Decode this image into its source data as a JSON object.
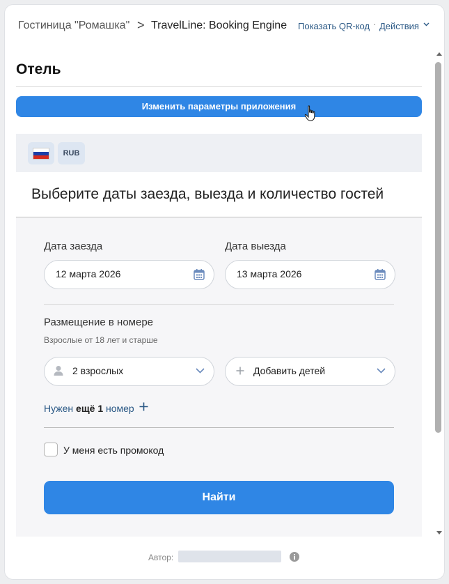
{
  "header": {
    "breadcrumb_parent": "Гостиница \"Ромашка\"",
    "breadcrumb_separator": ">",
    "breadcrumb_current": "TravelLine: Booking Engine",
    "show_qr": "Показать QR-код",
    "dot": "·",
    "actions": "Действия"
  },
  "section": {
    "title": "Отель",
    "change_button": "Изменить параметры приложения"
  },
  "widget": {
    "currency": "RUB",
    "heading": "Выберите даты заезда, выезда и количество гостей",
    "checkin": {
      "label": "Дата заезда",
      "value": "12 марта 2026"
    },
    "checkout": {
      "label": "Дата выезда",
      "value": "13 марта 2026"
    },
    "placement": {
      "label": "Размещение в номере",
      "note": "Взрослые от 18 лет и старше",
      "adults": "2 взрослых",
      "children": "Добавить детей"
    },
    "more_room": {
      "prefix": "Нужен",
      "bold": "ещё 1",
      "suffix": "номер"
    },
    "promo_label": "У меня есть промокод",
    "search_button": "Найти"
  },
  "footer": {
    "author_label": "Автор:"
  },
  "colors": {
    "accent": "#2f86e5",
    "link": "#2a5885"
  }
}
